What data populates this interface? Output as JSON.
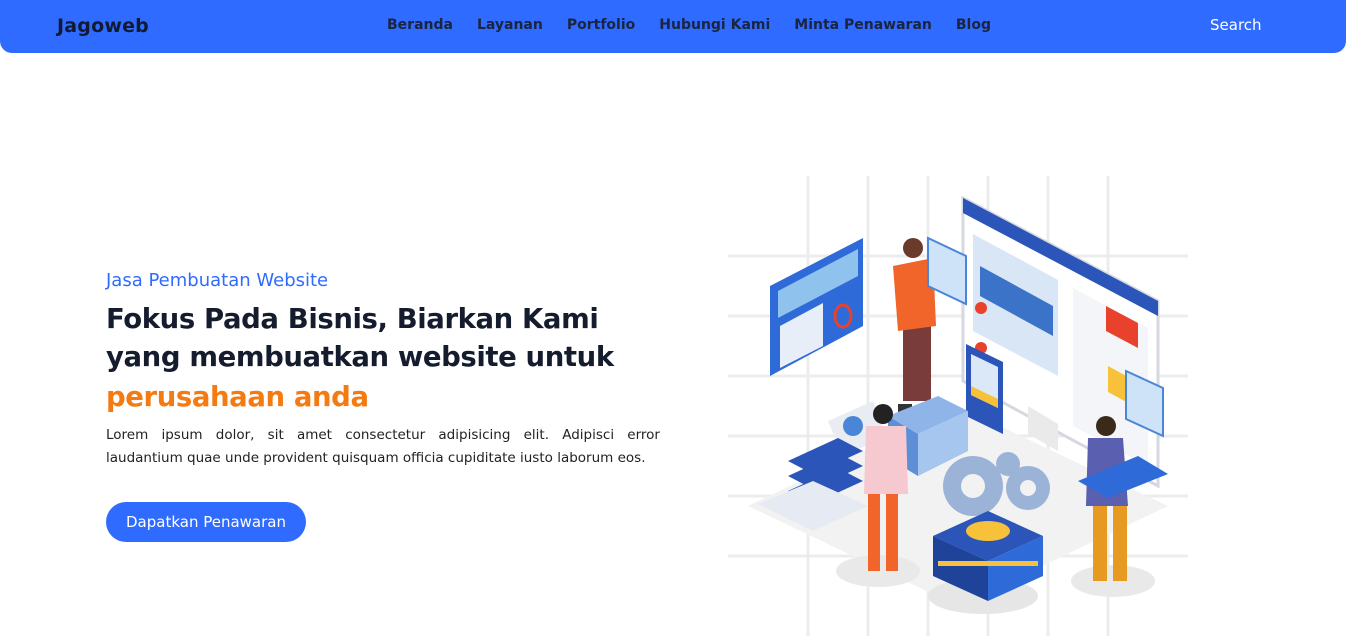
{
  "nav": {
    "brand": "Jagoweb",
    "links": [
      "Beranda",
      "Layanan",
      "Portfolio",
      "Hubungi Kami",
      "Minta Penawaran",
      "Blog"
    ],
    "search_label": "Search"
  },
  "hero": {
    "eyebrow": "Jasa Pembuatan Website",
    "headline_main": "Fokus Pada Bisnis, Biarkan Kami yang membuatkan website untuk",
    "headline_accent": "perusahaan anda",
    "lead": "Lorem ipsum dolor, sit amet consectetur adipisicing elit. Adipisci error laudantium quae unde provident quisquam officia cupiditate iusto laborum eos.",
    "cta_label": "Dapatkan Penawaran"
  },
  "colors": {
    "primary": "#2f6bff",
    "accent": "#f47a12",
    "heading": "#151c2e"
  },
  "illustration": {
    "icon": "isometric-web-development-illustration"
  }
}
